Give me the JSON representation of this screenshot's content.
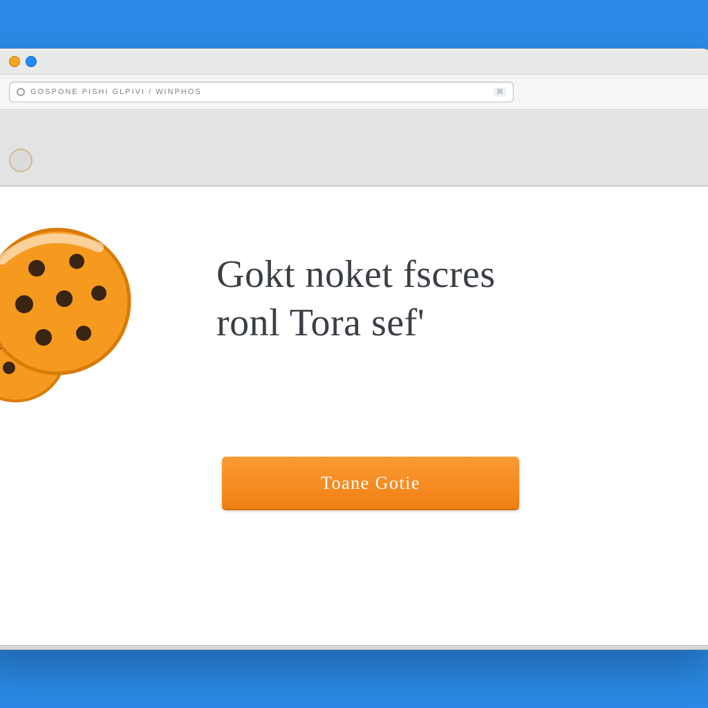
{
  "colors": {
    "page_bg": "#2a8ae5",
    "chrome_bg": "#e9e9e9",
    "toolbar_bg": "#e3e3e3",
    "content_bg": "#ffffff",
    "text": "#3a3f45",
    "cta_top": "#fa9a34",
    "cta_bottom": "#f17f12",
    "cookie_fill": "#f59a1f",
    "cookie_edge": "#d97b08",
    "chip": "#3a2413"
  },
  "browser": {
    "url_text": "GOSPONE  PISHI  GLPIVI / WINPHOS",
    "url_badge": "⌘"
  },
  "dialog": {
    "line1": "Gokt noket fscres",
    "line2": "ronl Tora sef'"
  },
  "cta": {
    "label": "Toane Gotie"
  }
}
